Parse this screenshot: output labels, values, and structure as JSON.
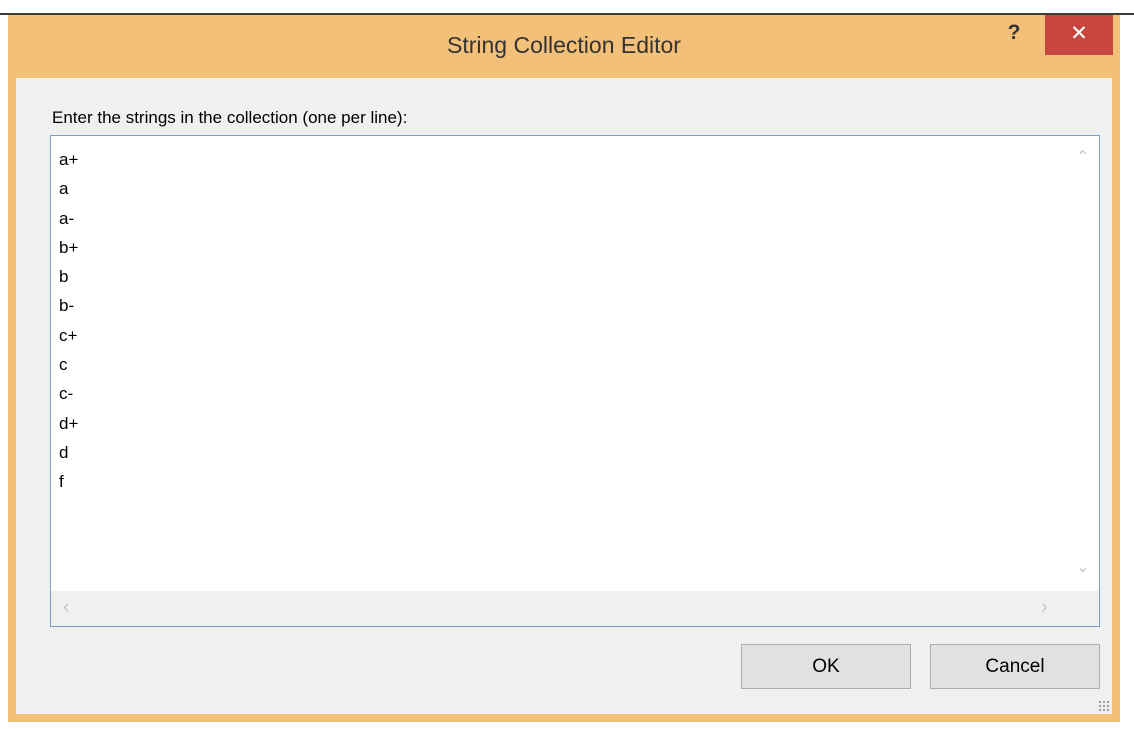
{
  "window": {
    "title": "String Collection Editor",
    "help_label": "?",
    "close_label": "✕"
  },
  "prompt": "Enter the strings in the collection (one per line):",
  "strings": [
    "a+",
    "a",
    "a-",
    "b+",
    "b",
    "b-",
    "c+",
    "c",
    "c-",
    "d+",
    "d",
    "f"
  ],
  "scroll_icons": {
    "up": "⌃",
    "down": "⌄",
    "left": "‹",
    "right": "›"
  },
  "buttons": {
    "ok": "OK",
    "cancel": "Cancel"
  },
  "colors": {
    "title_bar": "#f3c07a",
    "close_button": "#c7463f",
    "text_area_border": "#7a9ec7"
  }
}
